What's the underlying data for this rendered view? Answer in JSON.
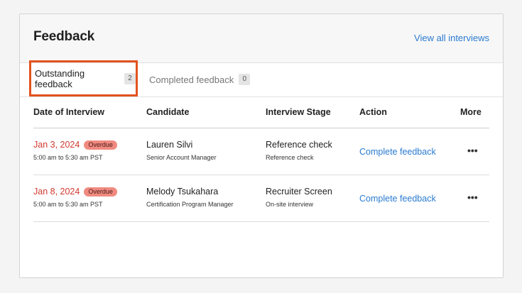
{
  "card": {
    "title": "Feedback",
    "view_all_label": "View all interviews"
  },
  "tabs": [
    {
      "label": "Outstanding feedback",
      "count": "2",
      "active": true
    },
    {
      "label": "Completed feedback",
      "count": "0",
      "active": false
    }
  ],
  "table": {
    "headers": {
      "date": "Date of Interview",
      "candidate": "Candidate",
      "stage": "Interview Stage",
      "action": "Action",
      "more": "More"
    },
    "rows": [
      {
        "date": "Jan 3, 2024",
        "status": "Overdue",
        "time": "5:00 am to 5:30 am PST",
        "candidate_name": "Lauren Silvi",
        "candidate_role": "Senior Account Manager",
        "stage": "Reference check",
        "stage_detail": "Reference check",
        "action_label": "Complete feedback",
        "more_icon": "more-horizontal-icon"
      },
      {
        "date": "Jan 8, 2024",
        "status": "Overdue",
        "time": "5:00 am to 5:30 am PST",
        "candidate_name": "Melody Tsukahara",
        "candidate_role": "Certification Program Manager",
        "stage": "Recruiter Screen",
        "stage_detail": "On-site interview",
        "action_label": "Complete feedback",
        "more_icon": "more-horizontal-icon"
      }
    ]
  },
  "colors": {
    "accent_link": "#2a7bd1",
    "overdue_text": "#d03a2f",
    "overdue_badge": "#f08a80",
    "active_tab_highlight": "#e2531f"
  }
}
